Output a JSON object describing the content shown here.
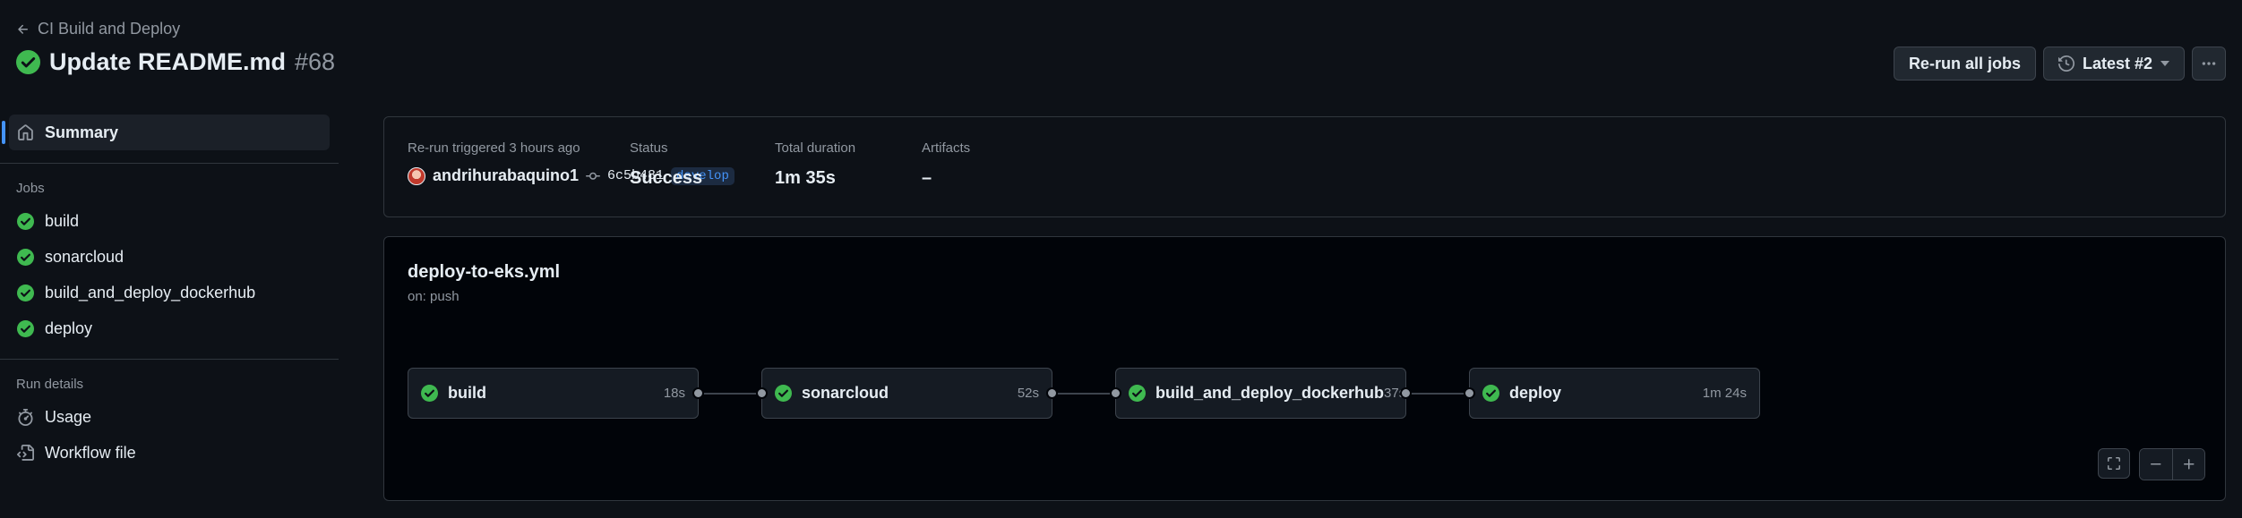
{
  "header": {
    "back_label": "CI Build and Deploy",
    "title": "Update README.md",
    "run_number": "#68",
    "rerun_button": "Re-run all jobs",
    "attempt_button": "Latest #2",
    "more_icon": "kebab-horizontal-icon"
  },
  "sidebar": {
    "summary_label": "Summary",
    "jobs_heading": "Jobs",
    "jobs": [
      {
        "label": "build",
        "status": "success"
      },
      {
        "label": "sonarcloud",
        "status": "success"
      },
      {
        "label": "build_and_deploy_dockerhub",
        "status": "success"
      },
      {
        "label": "deploy",
        "status": "success"
      }
    ],
    "run_details_heading": "Run details",
    "usage_label": "Usage",
    "workflow_file_label": "Workflow file"
  },
  "summary": {
    "trigger_label": "Re-run triggered 3 hours ago",
    "actor": "andrihurabaquino1",
    "commit_sha": "6c5b481",
    "branch": "develop",
    "status_label": "Status",
    "status_value": "Success",
    "duration_label": "Total duration",
    "duration_value": "1m 35s",
    "artifacts_label": "Artifacts",
    "artifacts_value": "–"
  },
  "graph": {
    "workflow_file": "deploy-to-eks.yml",
    "trigger": "on: push",
    "jobs": [
      {
        "name": "build",
        "duration": "18s"
      },
      {
        "name": "sonarcloud",
        "duration": "52s"
      },
      {
        "name": "build_and_deploy_dockerhub",
        "duration": "37s"
      },
      {
        "name": "deploy",
        "duration": "1m 24s"
      }
    ]
  },
  "colors": {
    "success": "#3fb950",
    "accent": "#4493f8",
    "background": "#0d1117"
  }
}
